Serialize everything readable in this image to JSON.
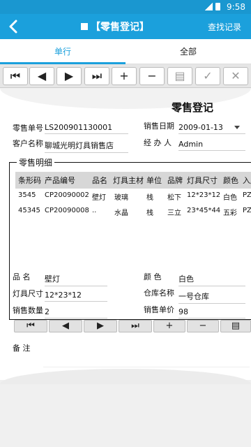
{
  "status_bar": {
    "time": "9:58"
  },
  "header": {
    "back_icon": "back-arrow-icon",
    "title": "【零售登记】",
    "action": "查找记录"
  },
  "tabs": [
    {
      "label": "单行"
    },
    {
      "label": "全部"
    }
  ],
  "toolbar": {
    "first": "⏮",
    "prev": "◀",
    "next": "▶",
    "last": "⏭",
    "add": "+",
    "remove": "−",
    "copy": "▤",
    "confirm": "✓",
    "cancel": "✕"
  },
  "form": {
    "title": "零售登记",
    "sale_no_label": "零售单号",
    "sale_no": "LS200901130001",
    "sale_date_label": "销售日期",
    "sale_date": "2009-01-13",
    "customer_label": "客户名称",
    "customer": "聊城光明灯具销售店",
    "handler_label": "经 办 人",
    "handler": "Admin"
  },
  "detail": {
    "title": "零售明细",
    "columns": [
      "条形码",
      "产品编号",
      "品名",
      "灯具主材",
      "单位",
      "品牌",
      "灯具尺寸",
      "颜色",
      "入库"
    ],
    "rows": [
      [
        "3545",
        "CP20090002",
        "壁灯",
        "玻璃",
        "栈",
        "松下",
        "12*23*12",
        "白色",
        "PZ"
      ],
      [
        "45345",
        "CP20090008",
        "..",
        "水晶",
        "栈",
        "三立",
        "23*45*44",
        "五彩",
        "PZ"
      ]
    ],
    "name_label": "品 名",
    "name": "壁灯",
    "color_label": "颜 色",
    "color": "白色",
    "size_label": "灯具尺寸",
    "size": "12*23*12",
    "warehouse_label": "仓库名称",
    "warehouse": "一号仓库",
    "qty_label": "销售数量",
    "qty": "2",
    "price_label": "销售单价",
    "price": "98"
  },
  "sub_toolbar": {
    "first": "⏮",
    "prev": "◀",
    "next": "▶",
    "last": "⏭",
    "add": "+",
    "remove": "−",
    "copy": "▤"
  },
  "remark": {
    "label": "备 注",
    "value": ""
  },
  "colors": {
    "primary": "#1ba0dc",
    "status": "#1a97d0"
  }
}
